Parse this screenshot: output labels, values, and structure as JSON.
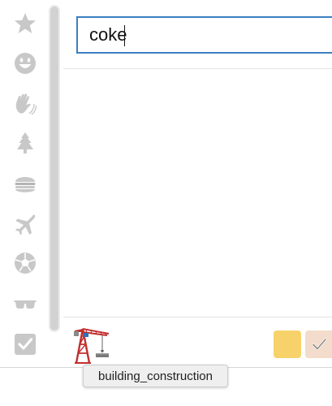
{
  "search": {
    "value": "coke",
    "placeholder": ""
  },
  "categories": [
    {
      "id": "frequent",
      "icon": "star-icon"
    },
    {
      "id": "people",
      "icon": "smiley-icon"
    },
    {
      "id": "nature-hands",
      "icon": "waving-hands-icon"
    },
    {
      "id": "nature",
      "icon": "evergreen-tree-icon"
    },
    {
      "id": "food",
      "icon": "hamburger-icon"
    },
    {
      "id": "travel",
      "icon": "airplane-icon"
    },
    {
      "id": "activity",
      "icon": "soccer-ball-icon"
    },
    {
      "id": "objects",
      "icon": "sunglasses-icon"
    },
    {
      "id": "symbols",
      "icon": "check-box-icon"
    }
  ],
  "preview": {
    "emoji_icon": "building-construction-crane-icon"
  },
  "tooltip": {
    "label": "building_construction"
  },
  "skin_tones": [
    {
      "color": "#f7d26a"
    },
    {
      "color": "#f3dccb",
      "selected": true
    }
  ],
  "colors": {
    "search_border": "#3d7fc1",
    "category_icon": "#c8c8c8",
    "crane_red": "#c0302f"
  }
}
